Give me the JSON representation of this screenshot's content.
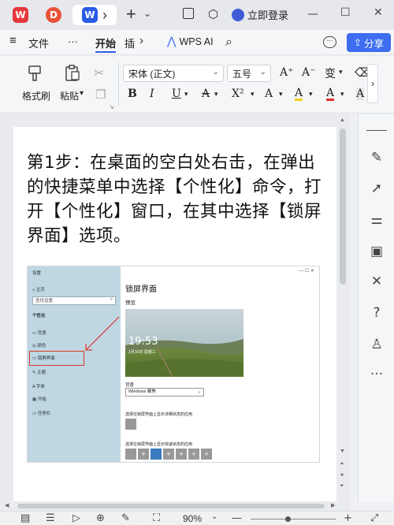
{
  "tabs": {
    "wps_letter": "W",
    "pdf_letter": "D",
    "doc_letter": "W",
    "more": "›",
    "new": "+",
    "login": "立即登录"
  },
  "menubar": {
    "hamburger": "≡",
    "file": "文件",
    "more": "···",
    "start": "开始",
    "insert": "插",
    "wps_ai": "WPS AI",
    "share": "分享"
  },
  "ribbon": {
    "format_painter": "格式刷",
    "paste": "粘贴",
    "font_name": "宋体 (正文)",
    "font_size": "五号",
    "grow": "A⁺",
    "shrink": "A⁻",
    "phonetic": "变",
    "bold": "B",
    "italic": "I",
    "underline": "U",
    "strike": "A",
    "superscript": "X²",
    "color_a": "A",
    "underline_color": "A",
    "font_color": "A",
    "chevron": "›"
  },
  "document": {
    "headline": "第1步：在桌面的空白处右击，在弹出的快捷菜单中选择【个性化】命令，打开【个性化】窗口，在其中选择【锁屏界面】选项。",
    "embedded": {
      "title_bar": "设置",
      "home": "主页",
      "search_placeholder": "查找设置",
      "section": "个性化",
      "items": [
        "背景",
        "颜色",
        "锁屏界面",
        "主题",
        "字体",
        "开始",
        "任务栏"
      ],
      "main_title": "锁屏界面",
      "preview": "预览",
      "clock": "19:53",
      "date": "1月10日 星期三",
      "bg_label": "背景",
      "bg_value": "Windows 聚焦",
      "detail_label": "选择在锁屏界面上显示详细状态的应用",
      "quick_label": "选择在锁屏界面上显示快速状态的应用"
    }
  },
  "statusbar": {
    "zoom": "90%"
  },
  "colors": {
    "wps_red": "#e5383b",
    "pdf_red": "#ea5136",
    "word_blue": "#2b5ce6",
    "share_blue": "#3d6df0",
    "highlight_box": "#d83a2b"
  }
}
